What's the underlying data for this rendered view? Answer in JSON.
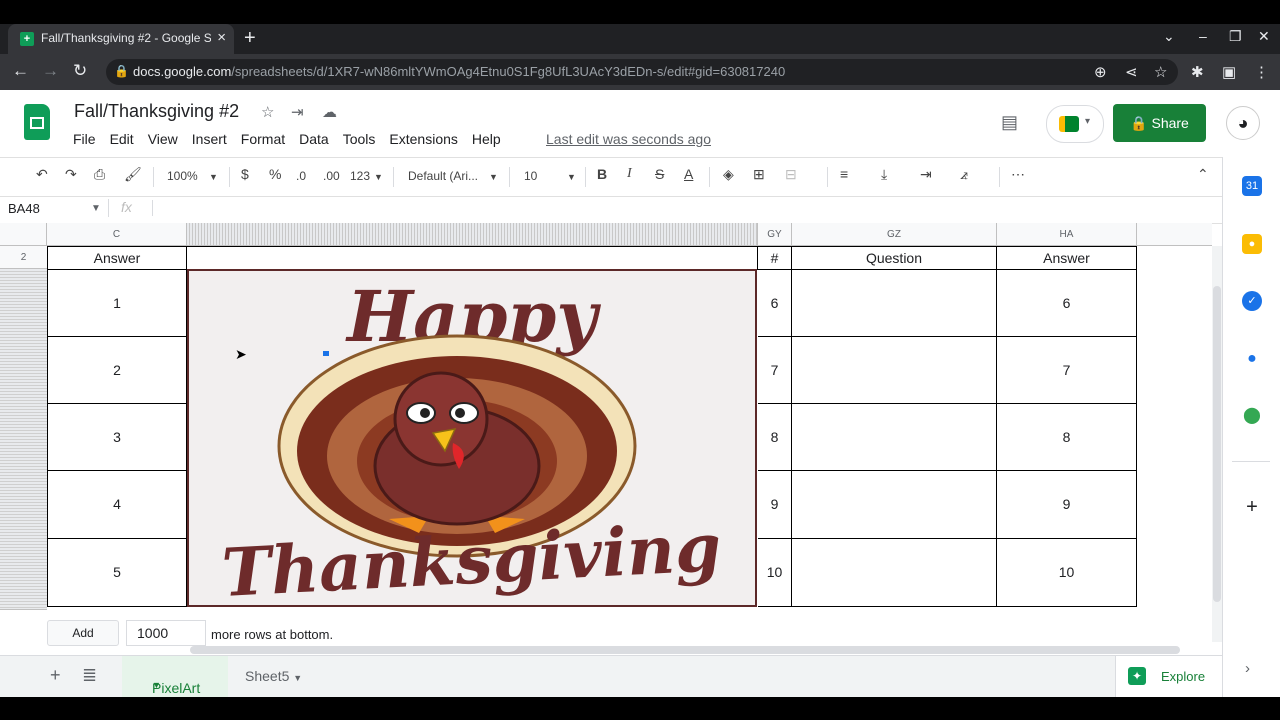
{
  "browser": {
    "tab_title": "Fall/Thanksgiving #2 - Google S",
    "url_host": "docs.google.com",
    "url_path": "/spreadsheets/d/1XR7-wN86mltYWmOAg4Etnu0S1Fg8UfL3UAcY3dEDn-s/edit#gid=630817240"
  },
  "doc": {
    "title": "Fall/Thanksgiving #2",
    "menu": [
      "File",
      "Edit",
      "View",
      "Insert",
      "Format",
      "Data",
      "Tools",
      "Extensions",
      "Help"
    ],
    "last_edit": "Last edit was seconds ago",
    "share_label": "Share"
  },
  "toolbar": {
    "zoom": "100%",
    "currency": "$",
    "percent": "%",
    "dec_less": ".0",
    "dec_more": ".00",
    "format_more": "123",
    "font": "Default (Ari...",
    "font_size": "10",
    "bold": "B",
    "italic": "I",
    "strike": "S",
    "text_color": "A"
  },
  "formula_bar": {
    "cell_ref": "BA48",
    "fx": "fx"
  },
  "columns": {
    "c": "C",
    "gy": "GY",
    "gz": "GZ",
    "ha": "HA"
  },
  "rows_header": {
    "row2": "2"
  },
  "headers": {
    "answer_left": "Answer",
    "hash": "#",
    "question": "Question",
    "answer_right": "Answer"
  },
  "left_answers": [
    "1",
    "2",
    "3",
    "4",
    "5"
  ],
  "right_numbers": [
    "6",
    "7",
    "8",
    "9",
    "10"
  ],
  "right_answers": [
    "6",
    "7",
    "8",
    "9",
    "10"
  ],
  "image": {
    "line1": "Happy",
    "line2": "Thanksgiving"
  },
  "add_rows": {
    "button": "Add",
    "value": "1000",
    "suffix": "more rows at bottom."
  },
  "sheets": {
    "active": "PixelArt",
    "other": "Sheet5"
  },
  "explore_label": "Explore",
  "colors": {
    "green": "#188038",
    "turkey_brown": "#6e2b2b"
  }
}
